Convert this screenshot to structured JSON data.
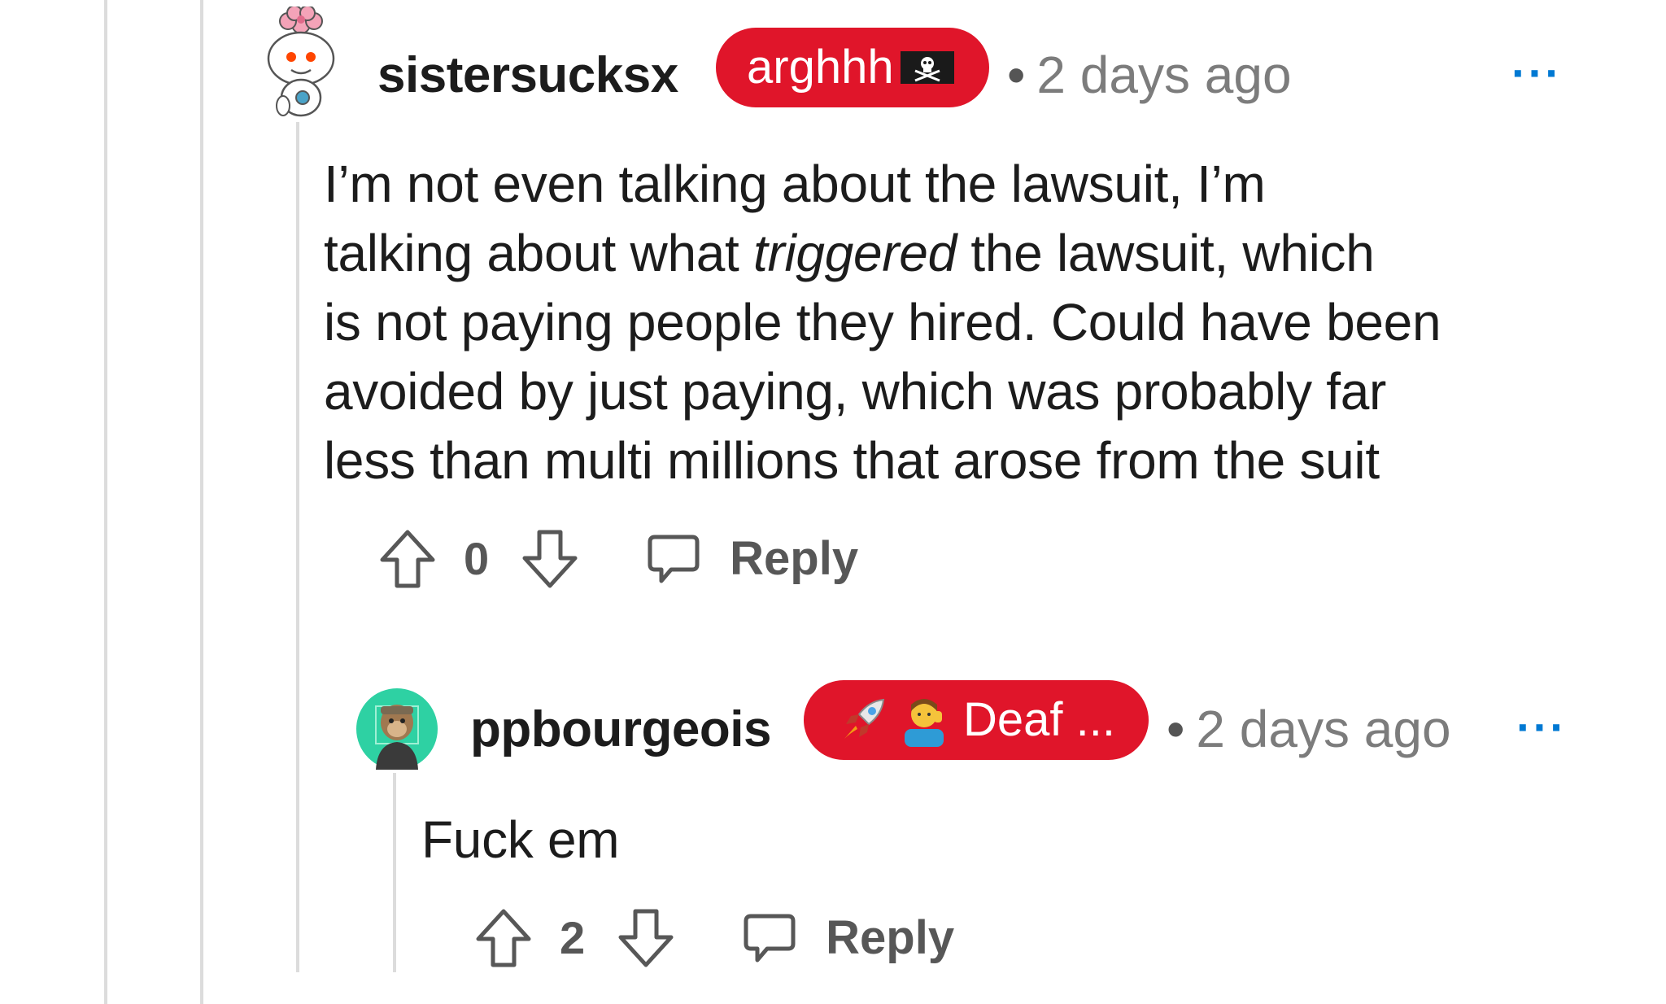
{
  "comments": [
    {
      "username": "sistersucksx",
      "flair": "arghhh",
      "flair_emoji": "pirate-flag-icon",
      "timestamp": "2 days ago",
      "separator": "•",
      "more_label": "···",
      "body_lines": [
        "I’m not even talking about the lawsuit, I’m",
        "talking about what ",
        "triggered",
        " the lawsuit, which",
        "is not paying people they hired. Could have been",
        "avoided by just paying, which was probably far",
        "less than multi millions that arose from the suit"
      ],
      "score": "0",
      "reply_label": "Reply"
    },
    {
      "username": "ppbourgeois",
      "flair": "Deaf ...",
      "flair_emojis": [
        "rocket-icon",
        "deaf-person-icon"
      ],
      "timestamp": "2 days ago",
      "separator": "•",
      "more_label": "···",
      "body": "Fuck em",
      "score": "2",
      "reply_label": "Reply"
    }
  ],
  "colors": {
    "flair_bg": "#e0152a",
    "more_blue": "#0079d3",
    "meta_gray": "#7c7c7c",
    "action_gray": "#575757",
    "thread_line": "#dcdcdc"
  }
}
